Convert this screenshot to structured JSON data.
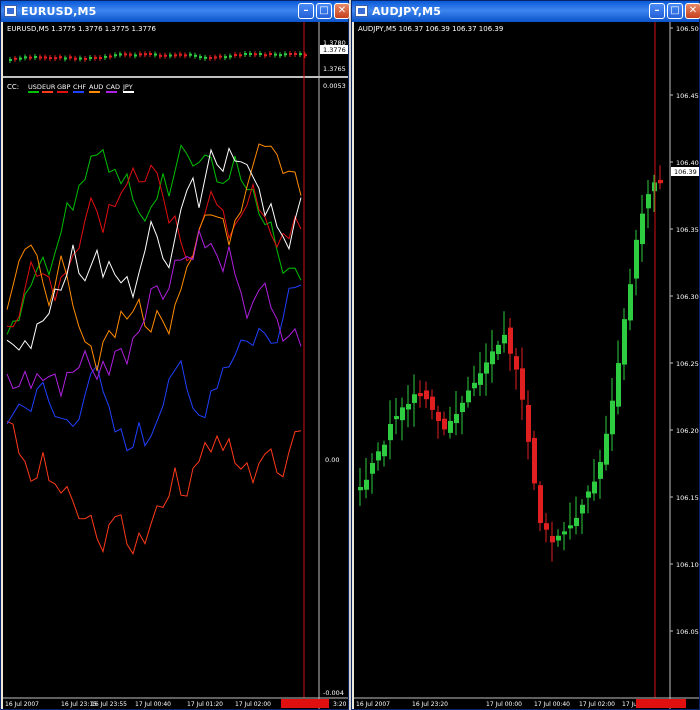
{
  "windows": [
    {
      "title": "EURUSD,M5",
      "buttons": {
        "minimize": "–",
        "maximize": "□",
        "close": "✕"
      },
      "main": {
        "header": "EURUSD,M5  1.3775 1.3776 1.3775 1.3776",
        "y_labels": [
          "1.3780",
          "1.3776",
          "1.3765"
        ]
      },
      "indicator": {
        "label": "CC:",
        "currencies": [
          {
            "name": "USD",
            "color": "#00c000"
          },
          {
            "name": "EUR",
            "color": "#ff3a1a"
          },
          {
            "name": "GBP",
            "color": "#e01010"
          },
          {
            "name": "CHF",
            "color": "#2040ff"
          },
          {
            "name": "AUD",
            "color": "#ff8c00"
          },
          {
            "name": "CAD",
            "color": "#b020e0"
          },
          {
            "name": "JPY",
            "color": "#ffffff"
          }
        ],
        "y_labels": [
          "0.0053",
          "0.00",
          "-0.004"
        ]
      },
      "x_labels": [
        "16 Jul 2007",
        "16 Jul 23:15",
        "16 Jul 23:55",
        "17 Jul 00:40",
        "17 Jul 01:20",
        "17 Jul 02:00",
        "3:20"
      ]
    },
    {
      "title": "AUDJPY,M5",
      "buttons": {
        "minimize": "–",
        "maximize": "□",
        "close": "✕"
      },
      "main": {
        "header": "AUDJPY,M5  106.37 106.39 106.37 106.39",
        "y_labels": [
          "106.50",
          "106.45",
          "106.40",
          "106.35",
          "106.30",
          "106.25",
          "106.20",
          "106.15",
          "106.10",
          "106.05"
        ],
        "current_price": "106.39"
      },
      "x_labels": [
        "16 Jul 2007",
        "16 Jul 23:20",
        "17 Jul 00:00",
        "17 Jul 00:40",
        "17 Jul 02:00",
        "17 Jul"
      ]
    }
  ]
}
